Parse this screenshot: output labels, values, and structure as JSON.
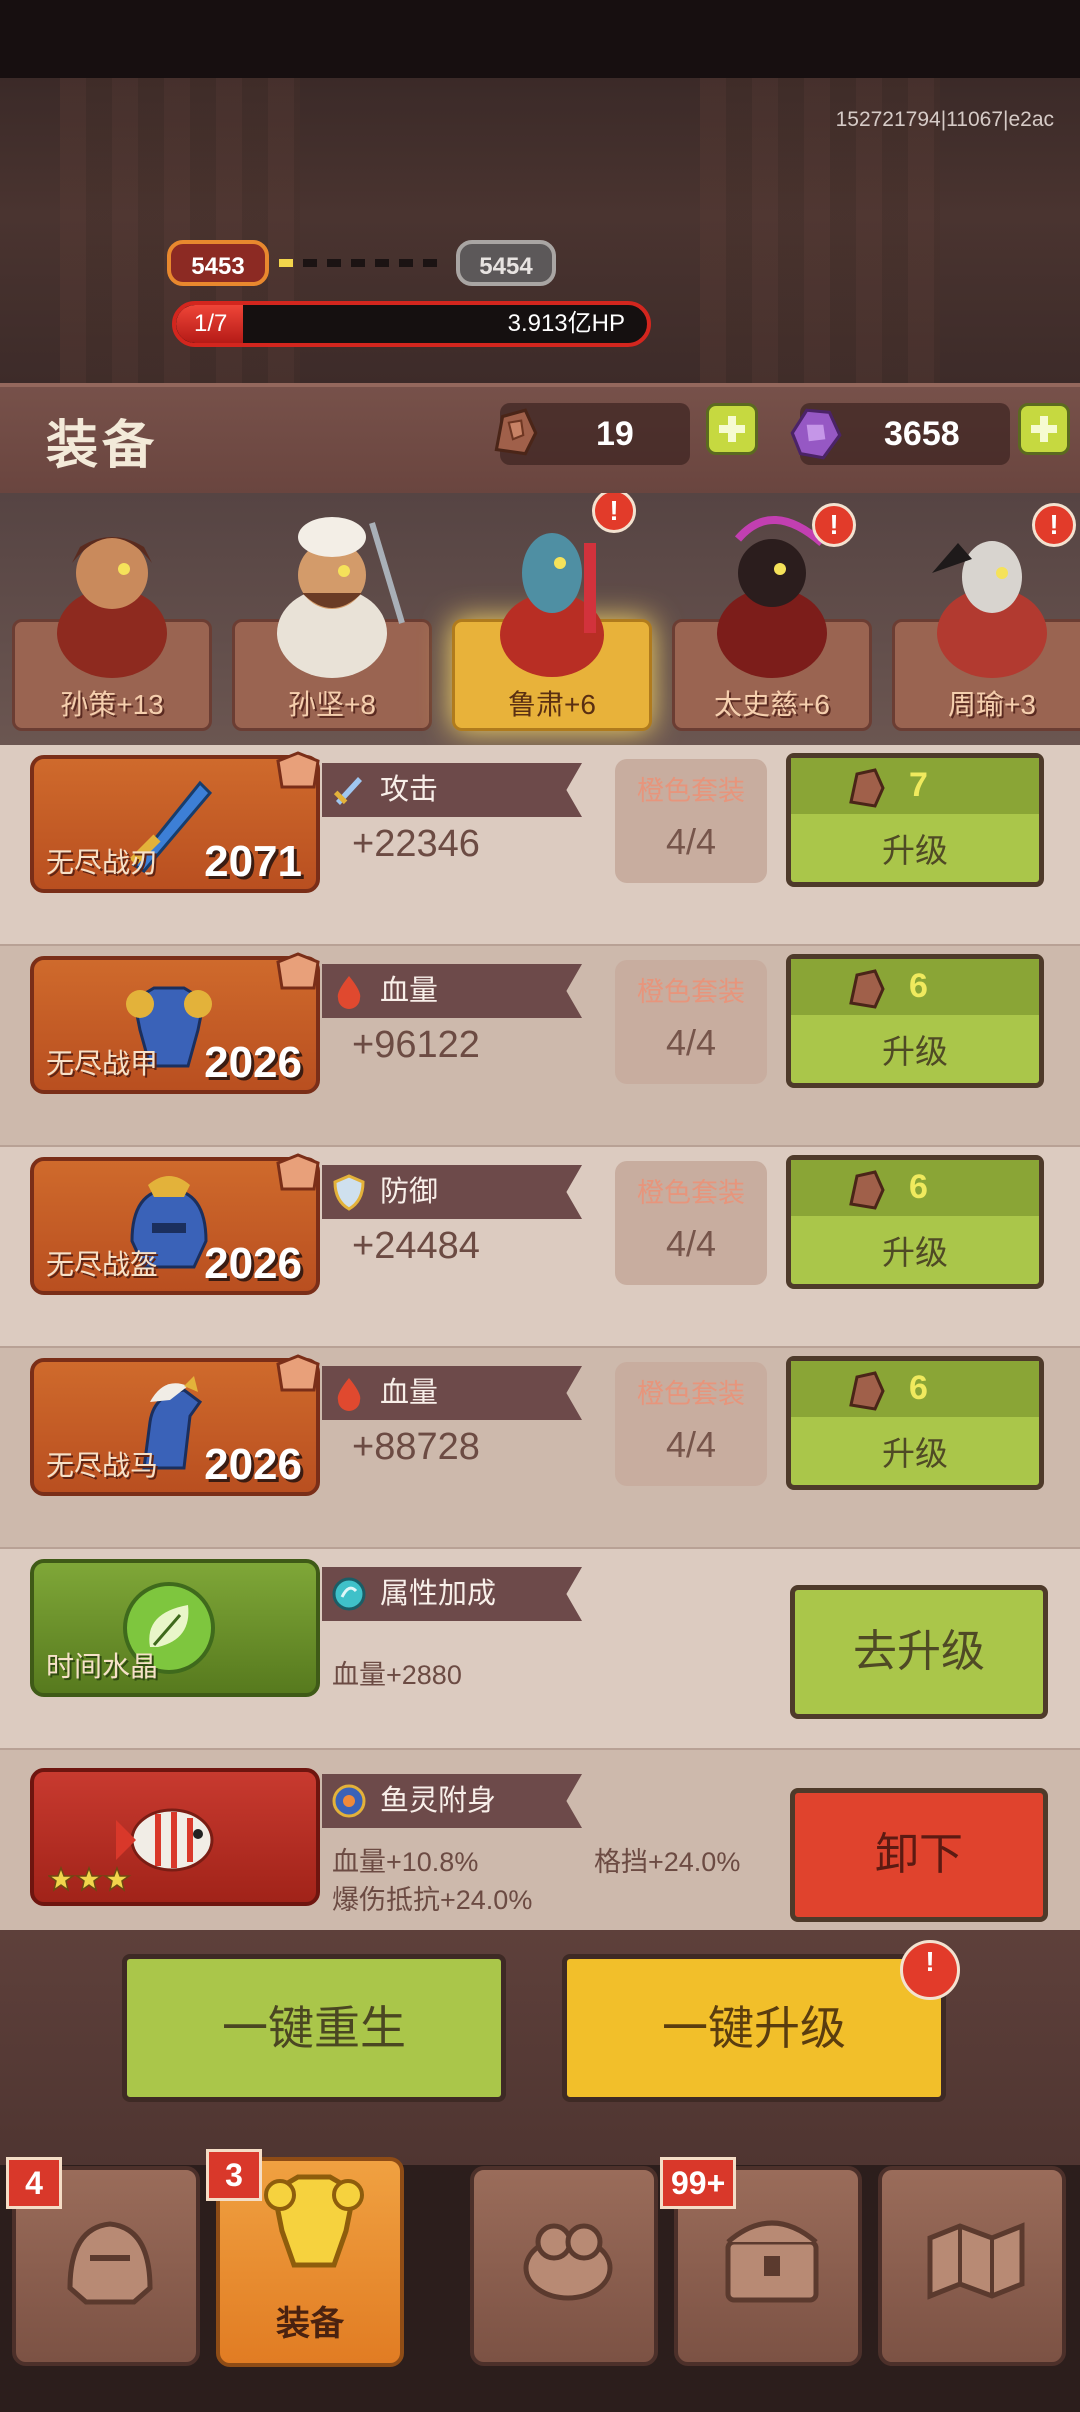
{
  "server_id": "152721794|11067|e2ac",
  "stage": {
    "current_level": "5453",
    "next_level": "5454",
    "hp_fraction": "1/7",
    "hp_text": "3.913亿HP",
    "hp_fill_fraction": 0.143
  },
  "header": {
    "title": "装备",
    "resource_ore": "19",
    "resource_crystal": "3658"
  },
  "heroes": [
    {
      "name": "孙策+13",
      "active": false,
      "alert": false
    },
    {
      "name": "孙坚+8",
      "active": false,
      "alert": false
    },
    {
      "name": "鲁肃+6",
      "active": true,
      "alert": true
    },
    {
      "name": "太史慈+6",
      "active": false,
      "alert": true
    },
    {
      "name": "周瑜+3",
      "active": false,
      "alert": true
    }
  ],
  "equipment": [
    {
      "name": "无尽战刃",
      "level": "2071",
      "attr_label": "攻击",
      "attr_icon": "sword-icon",
      "attr_value": "+22346",
      "set_title": "橙色套装",
      "set_count": "4/4",
      "upgrade_cost": "7",
      "upgrade_label": "升级"
    },
    {
      "name": "无尽战甲",
      "level": "2026",
      "attr_label": "血量",
      "attr_icon": "blood-drop-icon",
      "attr_value": "+96122",
      "set_title": "橙色套装",
      "set_count": "4/4",
      "upgrade_cost": "6",
      "upgrade_label": "升级"
    },
    {
      "name": "无尽战盔",
      "level": "2026",
      "attr_label": "防御",
      "attr_icon": "shield-icon",
      "attr_value": "+24484",
      "set_title": "橙色套装",
      "set_count": "4/4",
      "upgrade_cost": "6",
      "upgrade_label": "升级"
    },
    {
      "name": "无尽战马",
      "level": "2026",
      "attr_label": "血量",
      "attr_icon": "blood-drop-icon",
      "attr_value": "+88728",
      "set_title": "橙色套装",
      "set_count": "4/4",
      "upgrade_cost": "6",
      "upgrade_label": "升级"
    }
  ],
  "crystal": {
    "name": "时间水晶",
    "tag_label": "属性加成",
    "bonus": "血量+2880",
    "button_label": "去升级"
  },
  "fish_spirit": {
    "tag_label": "鱼灵附身",
    "stars": 3,
    "bonus_1": "血量+10.8%",
    "bonus_2": "格挡+24.0%",
    "bonus_3": "爆伤抵抗+24.0%",
    "button_label": "卸下"
  },
  "actions": {
    "rebirth_label": "一键重生",
    "upgrade_all_label": "一键升级"
  },
  "nav": [
    {
      "name": "heroes",
      "badge": "4",
      "label": "",
      "active": false
    },
    {
      "name": "equipment",
      "badge": "3",
      "label": "装备",
      "active": true
    },
    {
      "name": "treasure",
      "badge": "",
      "label": "",
      "active": false
    },
    {
      "name": "chest",
      "badge": "99+",
      "label": "",
      "active": false
    },
    {
      "name": "map",
      "badge": "",
      "label": "",
      "active": false
    }
  ],
  "colors": {
    "upgrade_green": "#aac64a",
    "unequip_red": "#e0432d",
    "upgrade_all_yellow": "#f2bf2a",
    "active_tab_orange": "#e17c23"
  }
}
